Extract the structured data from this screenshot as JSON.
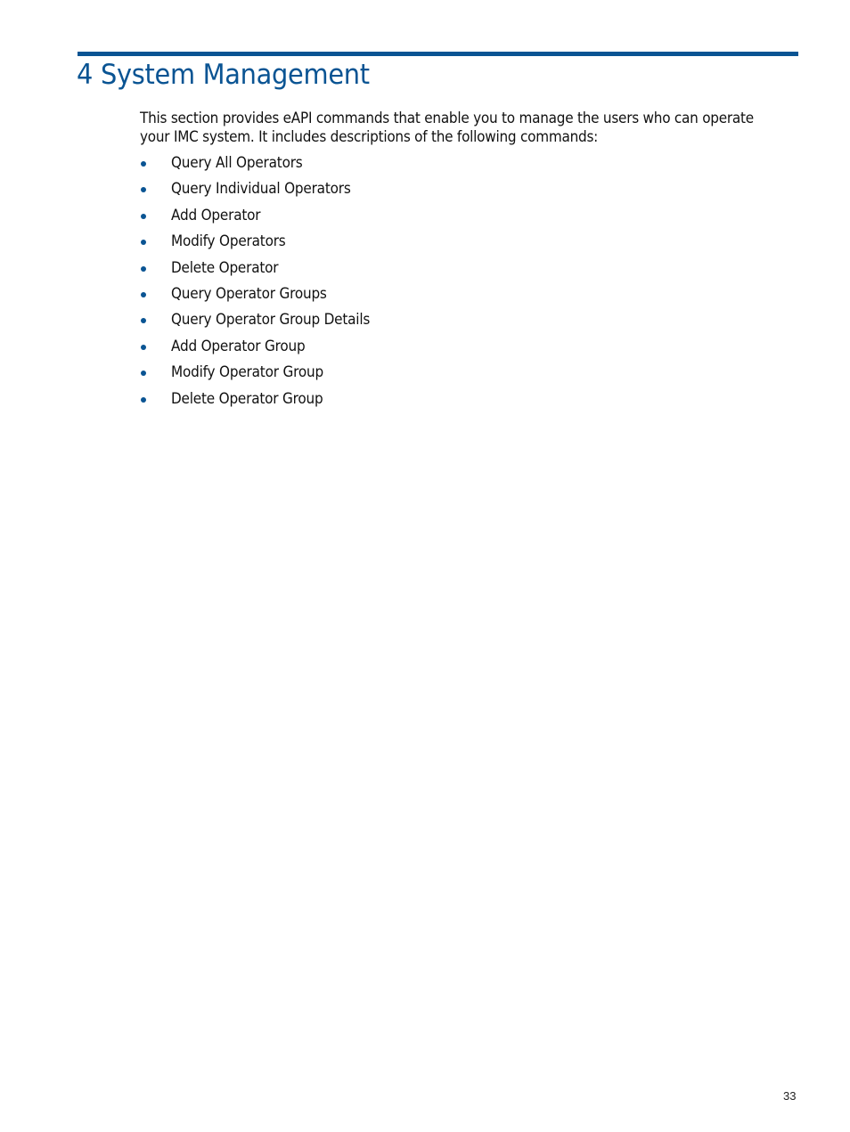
{
  "chapter": {
    "title": "4 System Management",
    "accent_color": "#0a5493"
  },
  "intro": "This section provides eAPI commands that enable you to manage the users who can operate your IMC system. It includes descriptions of the following commands:",
  "commands": [
    "Query All Operators",
    "Query Individual Operators",
    "Add Operator",
    "Modify Operators",
    "Delete Operator",
    "Query Operator Groups",
    "Query Operator Group Details",
    "Add Operator Group",
    "Modify Operator Group",
    "Delete Operator Group"
  ],
  "footer": {
    "page_number": "33"
  }
}
